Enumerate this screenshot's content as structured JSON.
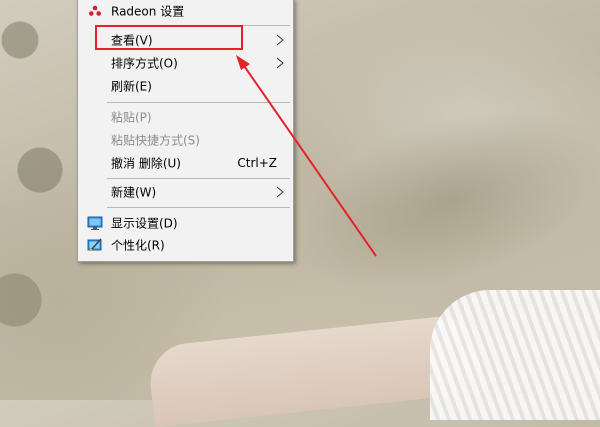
{
  "menu": {
    "items": [
      {
        "label": "Radeon 设置",
        "icon": "radeon-icon"
      },
      {
        "label": "查看(V)",
        "submenu": true,
        "icon": "chevron-right-icon"
      },
      {
        "label": "排序方式(O)",
        "submenu": true,
        "icon": "chevron-right-icon"
      },
      {
        "label": "刷新(E)"
      },
      {
        "label": "粘贴(P)",
        "disabled": true
      },
      {
        "label": "粘贴快捷方式(S)",
        "disabled": true
      },
      {
        "label": "撤消 删除(U)",
        "shortcut": "Ctrl+Z"
      },
      {
        "label": "新建(W)",
        "submenu": true,
        "icon": "chevron-right-icon"
      },
      {
        "label": "显示设置(D)",
        "icon": "display-settings-icon"
      },
      {
        "label": "个性化(R)",
        "icon": "personalize-icon"
      }
    ]
  },
  "colors": {
    "annotation": "#e2232a",
    "radeon": "#d0202a",
    "menu_bg": "#f2f2f2",
    "disabled_text": "#8d8d8d"
  }
}
